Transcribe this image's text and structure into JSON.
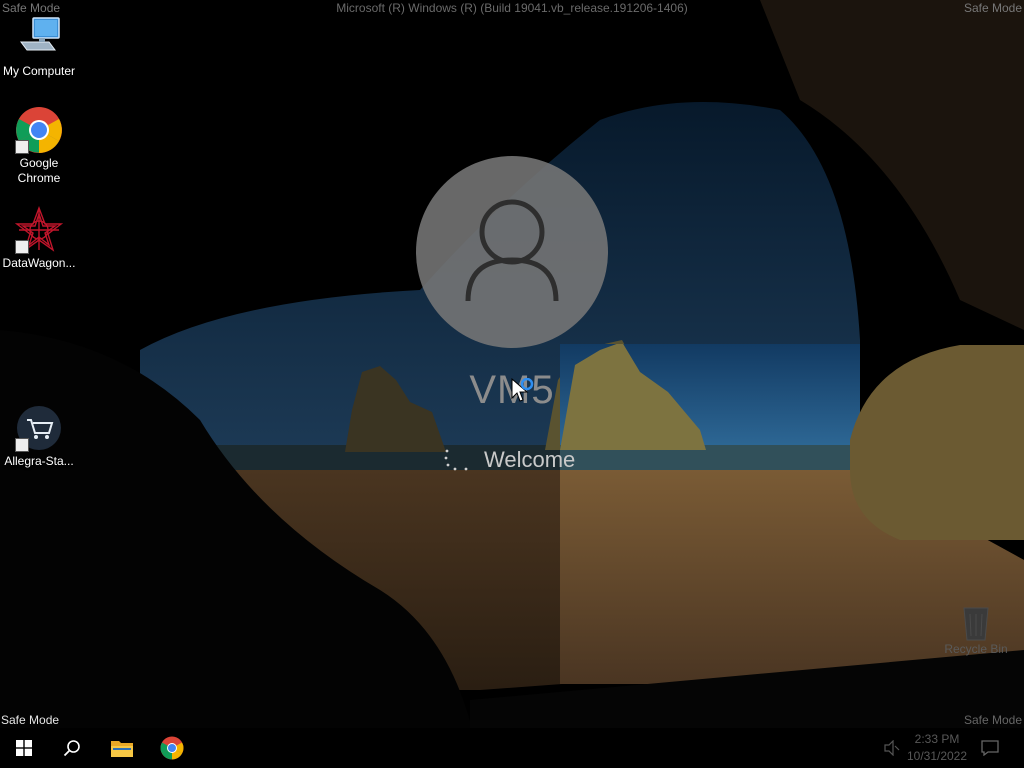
{
  "watermark": {
    "top_left": "Safe Mode",
    "top_right": "Safe Mode",
    "top_center": "Microsoft (R) Windows (R) (Build 19041.vb_release.191206-1406)",
    "bottom_left": "Safe Mode",
    "bottom_right": "Safe Mode"
  },
  "desktop_icons": [
    {
      "label": "My Computer",
      "icon": "computer-icon"
    },
    {
      "label": "Google Chrome",
      "icon": "chrome-icon"
    },
    {
      "label": "DataWagon...",
      "icon": "datawagon-icon"
    },
    {
      "label": "Allegra-Sta...",
      "icon": "shopping-cart-icon"
    }
  ],
  "recycle_bin": {
    "label": "Recycle Bin",
    "icon": "recycle-bin-icon"
  },
  "login": {
    "user_name": "VM5",
    "status": "Welcome",
    "avatar_icon": "user-icon"
  },
  "taskbar": {
    "buttons": [
      {
        "name": "start-button",
        "icon": "windows-logo-icon"
      },
      {
        "name": "search-button",
        "icon": "search-icon"
      },
      {
        "name": "file-explorer-button",
        "icon": "folder-icon"
      },
      {
        "name": "chrome-taskbar-button",
        "icon": "chrome-icon"
      }
    ],
    "clock_time": "2:33 PM",
    "clock_date": "10/31/2022",
    "tray_icons": [
      "volume-icon",
      "notification-icon"
    ]
  },
  "colors": {
    "sky": "#1d3b57",
    "sand": "#6e5230",
    "cave": "#0b0b0b",
    "avatar_bg": "#767676"
  }
}
